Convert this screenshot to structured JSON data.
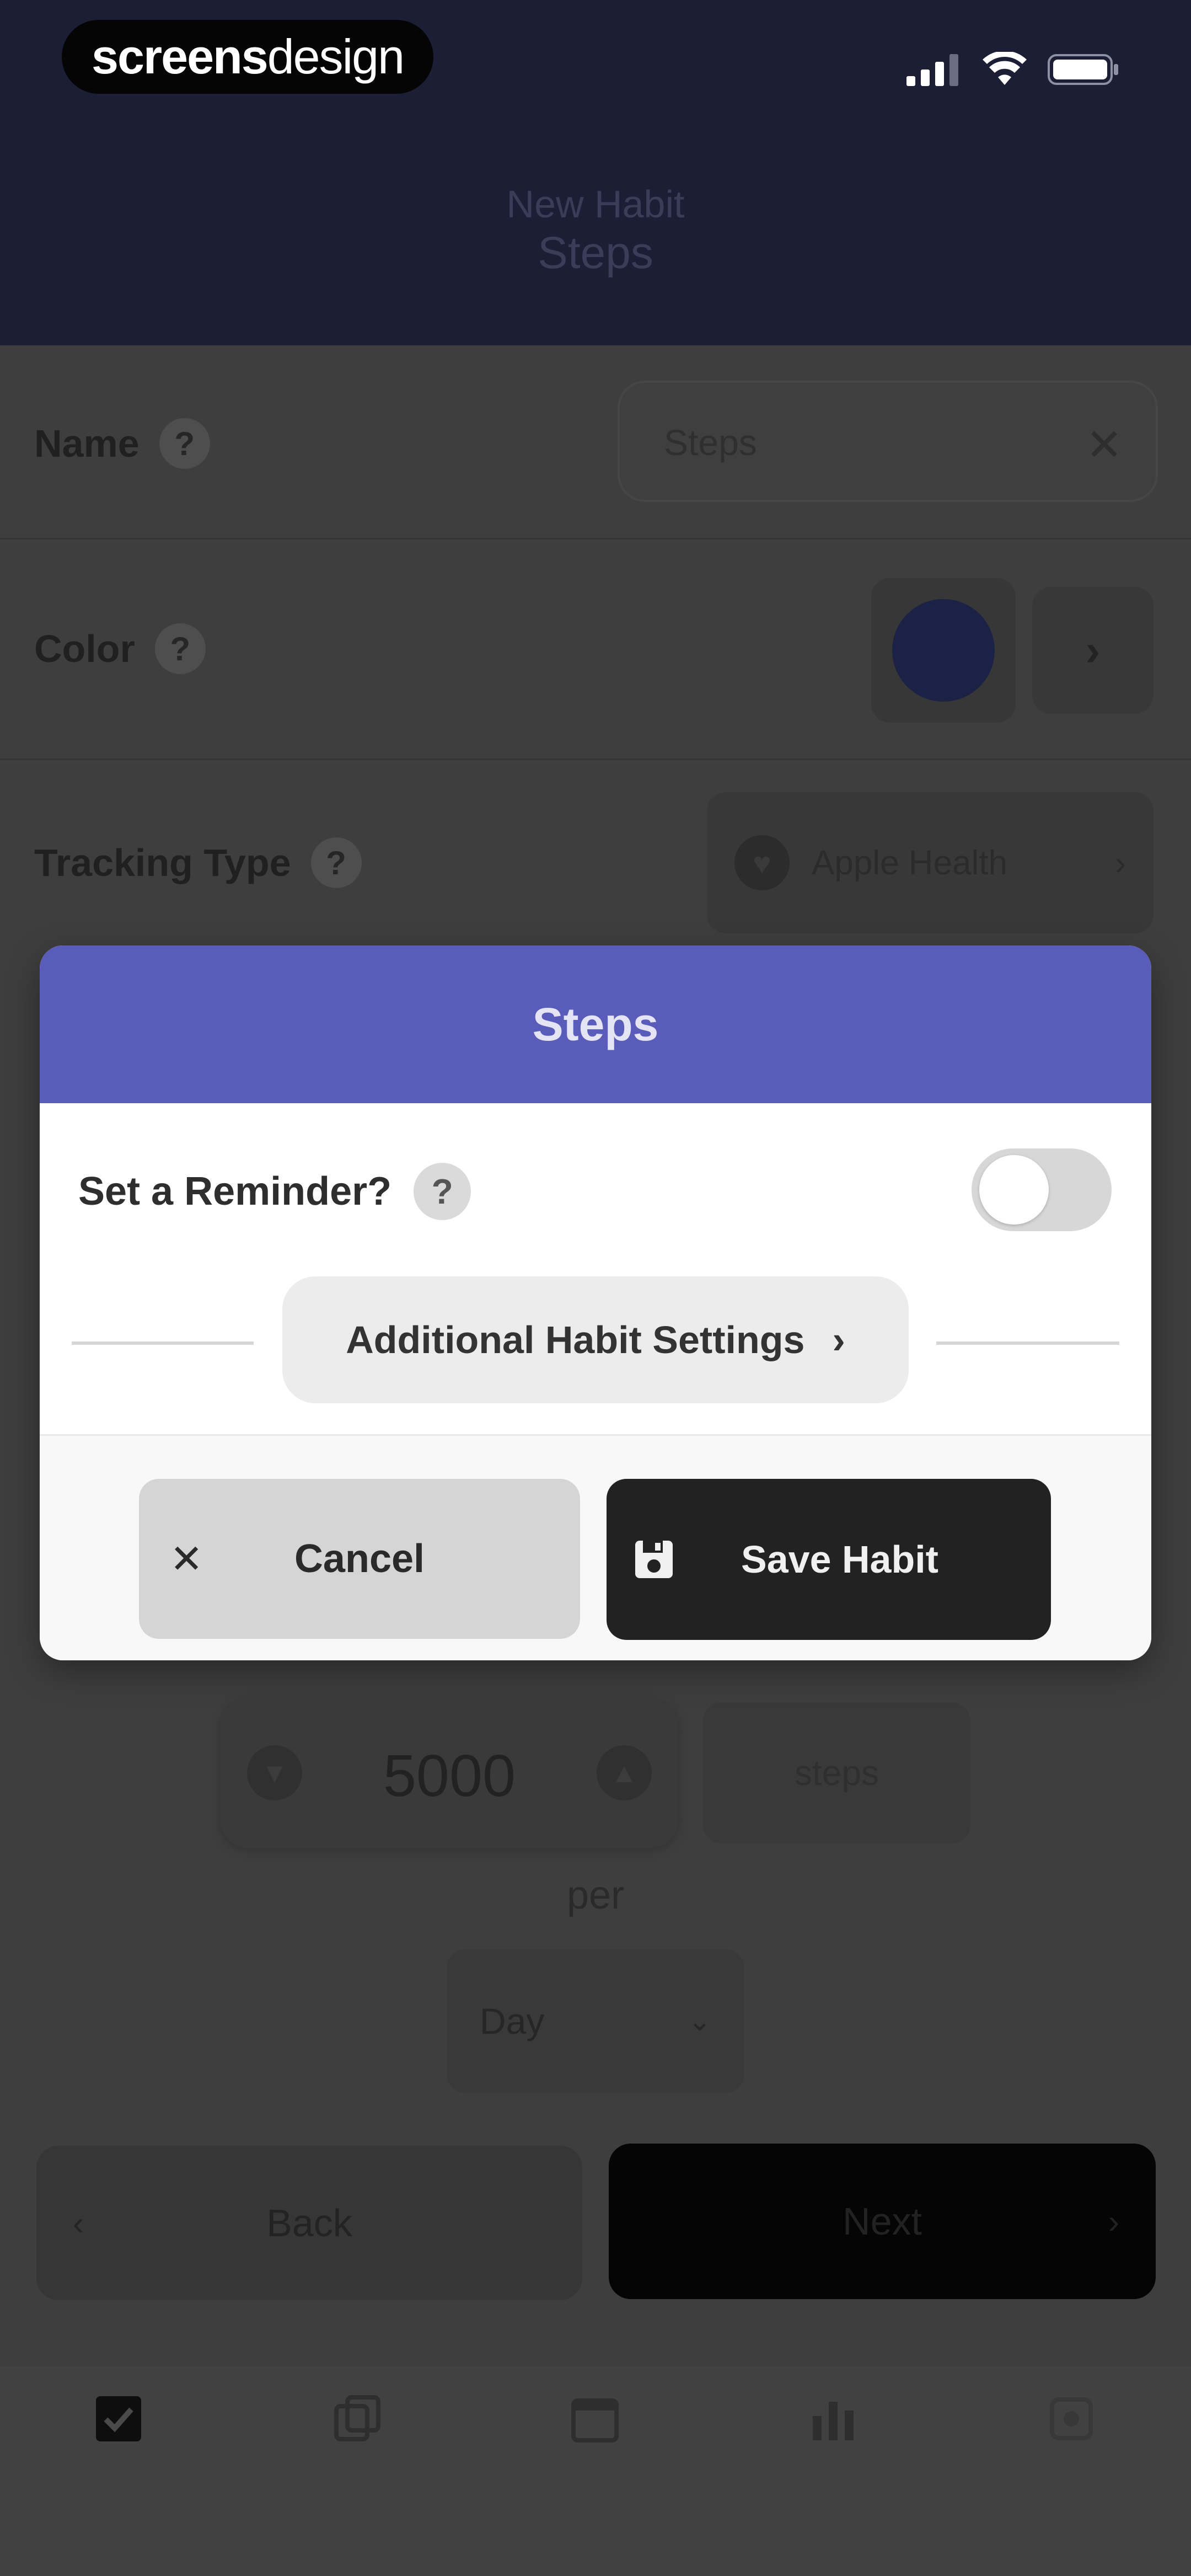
{
  "status_bar": {
    "brand_part1": "screens",
    "brand_part2": "design",
    "icons": [
      "cellular-signal-icon",
      "wifi-icon",
      "battery-icon"
    ]
  },
  "nav": {
    "overline": "New Habit",
    "title": "Steps"
  },
  "form": {
    "name_label": "Name",
    "name_value": "Steps",
    "color_label": "Color",
    "tracking_label": "Tracking Type",
    "tracking_value": "Apple Health",
    "goal_value": "5000",
    "goal_unit": "steps",
    "per_label": "per",
    "period_value": "Day",
    "help_glyph": "?"
  },
  "bottom_nav": {
    "back_label": "Back",
    "next_label": "Next"
  },
  "modal": {
    "title": "Steps",
    "reminder_label": "Set a Reminder?",
    "reminder_on": false,
    "additional_settings_label": "Additional Habit Settings",
    "cancel_label": "Cancel",
    "save_label": "Save Habit"
  },
  "colors": {
    "nav_bg": "#1b1e35",
    "modal_header": "#5a5cb9",
    "habit_color": "#1c2245",
    "save_button": "#222222"
  }
}
